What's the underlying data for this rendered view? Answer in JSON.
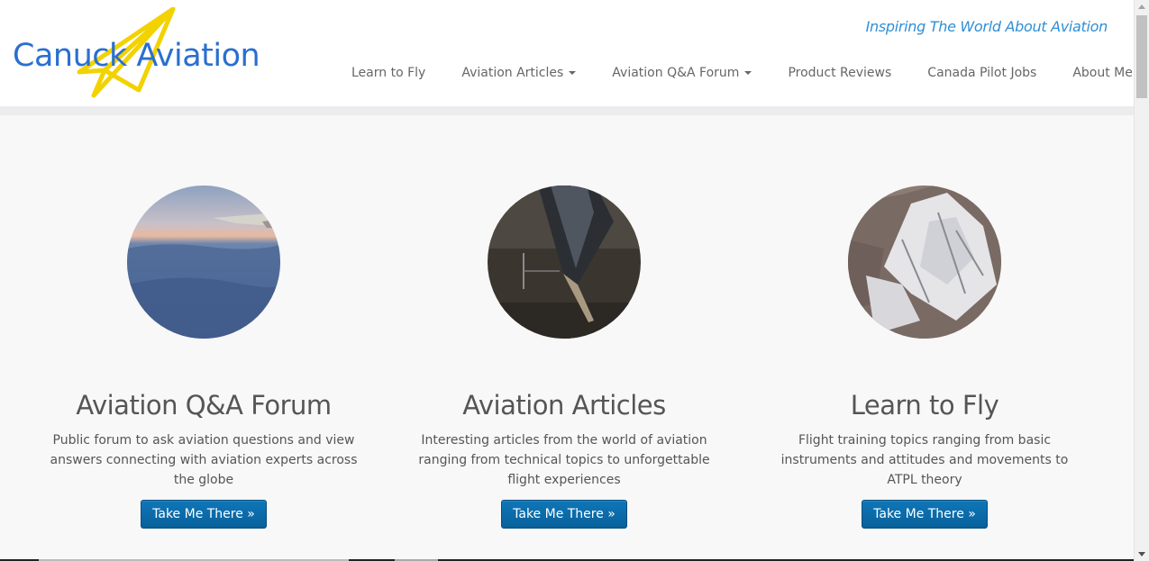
{
  "brand": {
    "logo_text": "Canuck Aviation",
    "tagline": "Inspiring The World About Aviation",
    "colors": {
      "logo_text": "#2a6fd0",
      "logo_plane": "#f2d200",
      "tagline": "#2f8fd6"
    }
  },
  "nav": {
    "items": [
      {
        "label": "Learn to Fly",
        "has_dropdown": false
      },
      {
        "label": "Aviation Articles",
        "has_dropdown": true
      },
      {
        "label": "Aviation Q&A Forum",
        "has_dropdown": true
      },
      {
        "label": "Product Reviews",
        "has_dropdown": false
      },
      {
        "label": "Canada Pilot Jobs",
        "has_dropdown": false
      },
      {
        "label": "About Me",
        "has_dropdown": true
      }
    ]
  },
  "features": [
    {
      "title": "Aviation Q&A Forum",
      "description": "Public forum to ask aviation questions and view answers connecting with aviation experts across the globe",
      "button_label": "Take Me There »",
      "image": "airplane-wing-above-clouds"
    },
    {
      "title": "Aviation Articles",
      "description": "Interesting articles from the world of aviation ranging from technical topics to unforgettable flight experiences",
      "button_label": "Take Me There »",
      "image": "jet-nose-in-hangar"
    },
    {
      "title": "Learn to Fly",
      "description": "Flight training topics ranging from basic instruments and attitudes and movements to ATPL theory",
      "button_label": "Take Me There »",
      "image": "snowy-mountain-aerial"
    }
  ],
  "theme": {
    "button_bg": "#0a6aa8",
    "page_bg": "#f8f8f8"
  }
}
